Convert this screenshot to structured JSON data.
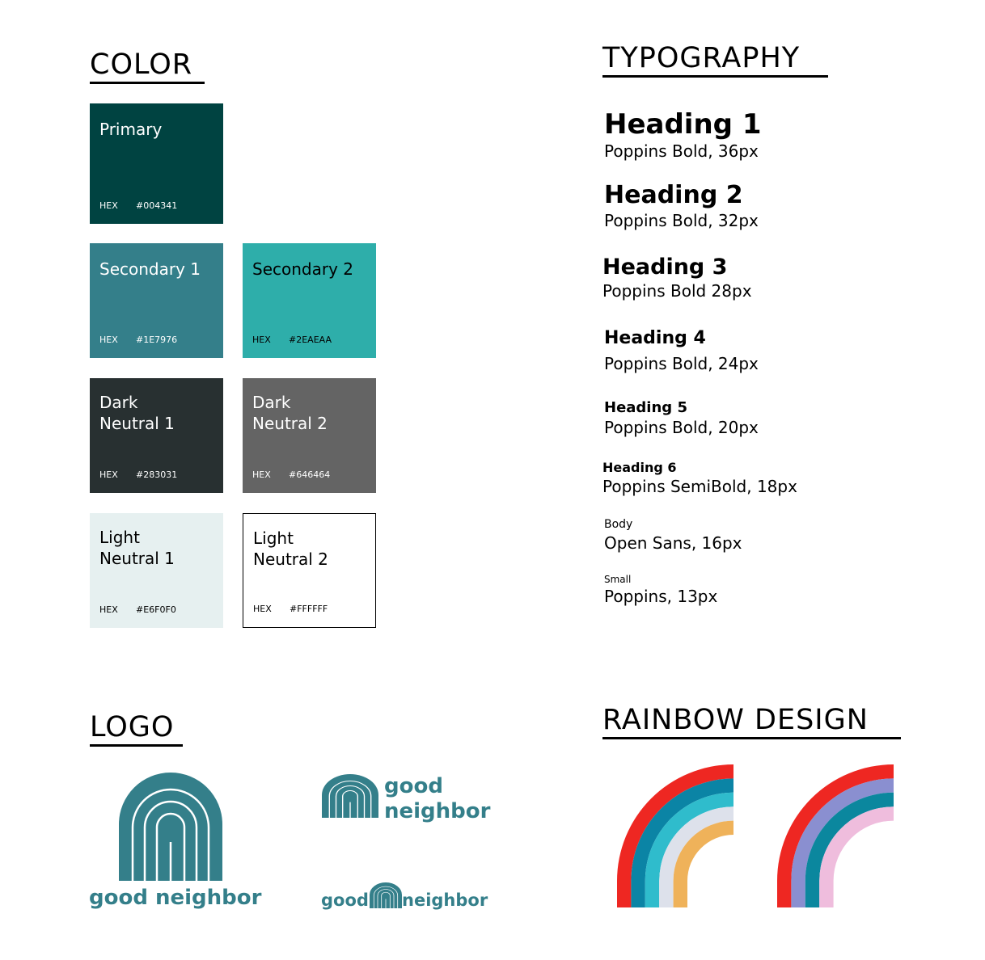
{
  "sections": {
    "color": "COLOR",
    "typography": "TYPOGRAPHY",
    "logo": "LOGO",
    "rainbow": "RAINBOW DESIGN"
  },
  "colors": [
    {
      "name": "Primary",
      "hex_label": "HEX",
      "hex": "#004341",
      "swatch": "#004341"
    },
    {
      "name": "Secondary 1",
      "hex_label": "HEX",
      "hex": "#1E7976",
      "swatch": "#347f8a"
    },
    {
      "name": "Secondary 2",
      "hex_label": "HEX",
      "hex": "#2EAEAA",
      "swatch": "#2eaeaa"
    },
    {
      "name": "Dark\nNeutral 1",
      "hex_label": "HEX",
      "hex": "#283031",
      "swatch": "#283031"
    },
    {
      "name": "Dark\nNeutral 2",
      "hex_label": "HEX",
      "hex": "#646464",
      "swatch": "#646464"
    },
    {
      "name": "Light\nNeutral 1",
      "hex_label": "HEX",
      "hex": "#E6F0F0",
      "swatch": "#e6f0f0"
    },
    {
      "name": "Light\nNeutral 2",
      "hex_label": "HEX",
      "hex": "#FFFFFF",
      "swatch": "#ffffff"
    }
  ],
  "typography": [
    {
      "sample": "Heading 1",
      "spec": "Poppins Bold, 36px"
    },
    {
      "sample": "Heading 2",
      "spec": "Poppins Bold, 32px"
    },
    {
      "sample": "Heading 3",
      "spec": "Poppins Bold 28px"
    },
    {
      "sample": "Heading 4",
      "spec": "Poppins Bold, 24px"
    },
    {
      "sample": "Heading 5",
      "spec": "Poppins Bold, 20px"
    },
    {
      "sample": "Heading 6",
      "spec": "Poppins SemiBold, 18px"
    },
    {
      "sample": "Body",
      "spec": "Open Sans, 16px"
    },
    {
      "sample": "Small",
      "spec": "Poppins, 13px"
    }
  ],
  "logo": {
    "brand_color": "#347f8a",
    "full_name": "good neighbor",
    "word1": "good",
    "word2": "neighbor"
  },
  "rainbows": [
    {
      "bands": [
        "#ee2722",
        "#0b84a5",
        "#2fbccc",
        "#dde1eb",
        "#efb25a"
      ]
    },
    {
      "bands": [
        "#ee2722",
        "#8a8fd0",
        "#0b879e",
        "#efbddd"
      ]
    }
  ]
}
